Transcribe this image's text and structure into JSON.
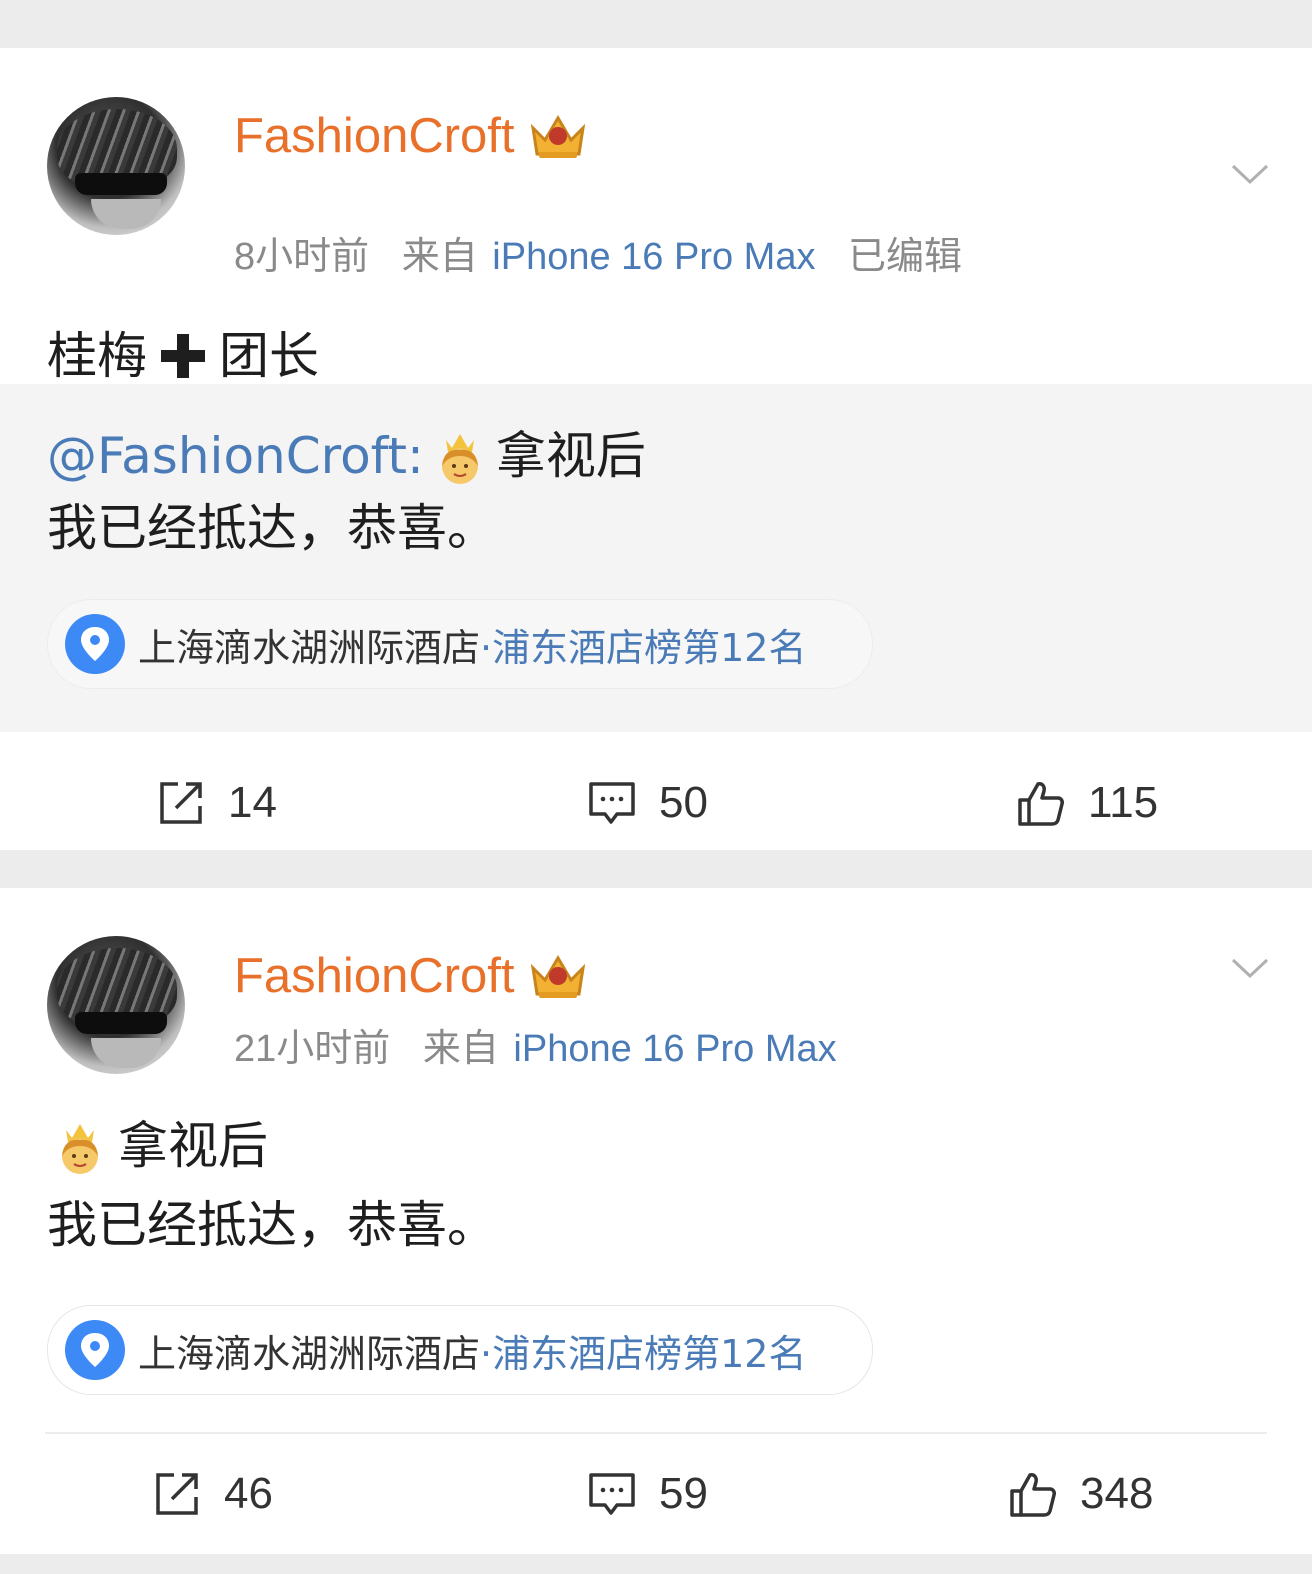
{
  "posts": [
    {
      "username": "FashionCroft",
      "time": "8小时前",
      "source_prefix": "来自",
      "device": "iPhone 16 Pro Max",
      "edited": "已编辑",
      "text_a": "桂梅",
      "text_b": "团长",
      "repost": {
        "mention": "@FashionCroft:",
        "line1": "拿视后",
        "line2": "我已经抵达，恭喜。",
        "location_name": "上海滴水湖洲际酒店",
        "location_rank": "·浦东酒店榜第12名"
      },
      "shares": "14",
      "comments": "50",
      "likes": "115"
    },
    {
      "username": "FashionCroft",
      "time": "21小时前",
      "source_prefix": "来自",
      "device": "iPhone 16 Pro Max",
      "line1": "拿视后",
      "line2": "我已经抵达，恭喜。",
      "location_name": "上海滴水湖洲际酒店",
      "location_rank": "·浦东酒店榜第12名",
      "shares": "46",
      "comments": "59",
      "likes": "348"
    }
  ],
  "icons": {
    "badge": "crown-badge-icon",
    "more": "chevron-down-icon",
    "plus": "heavy-plus-icon",
    "emoji": "princess-emoji-icon",
    "location": "location-pin-icon",
    "share": "share-icon",
    "comment": "comment-icon",
    "like": "thumbs-up-icon"
  },
  "colors": {
    "username": "#e8702a",
    "link": "#4a7bb7",
    "meta": "#8a8a8a",
    "gap": "#ececec",
    "repost_bg": "#f4f4f4",
    "pin": "#3d8af7"
  }
}
